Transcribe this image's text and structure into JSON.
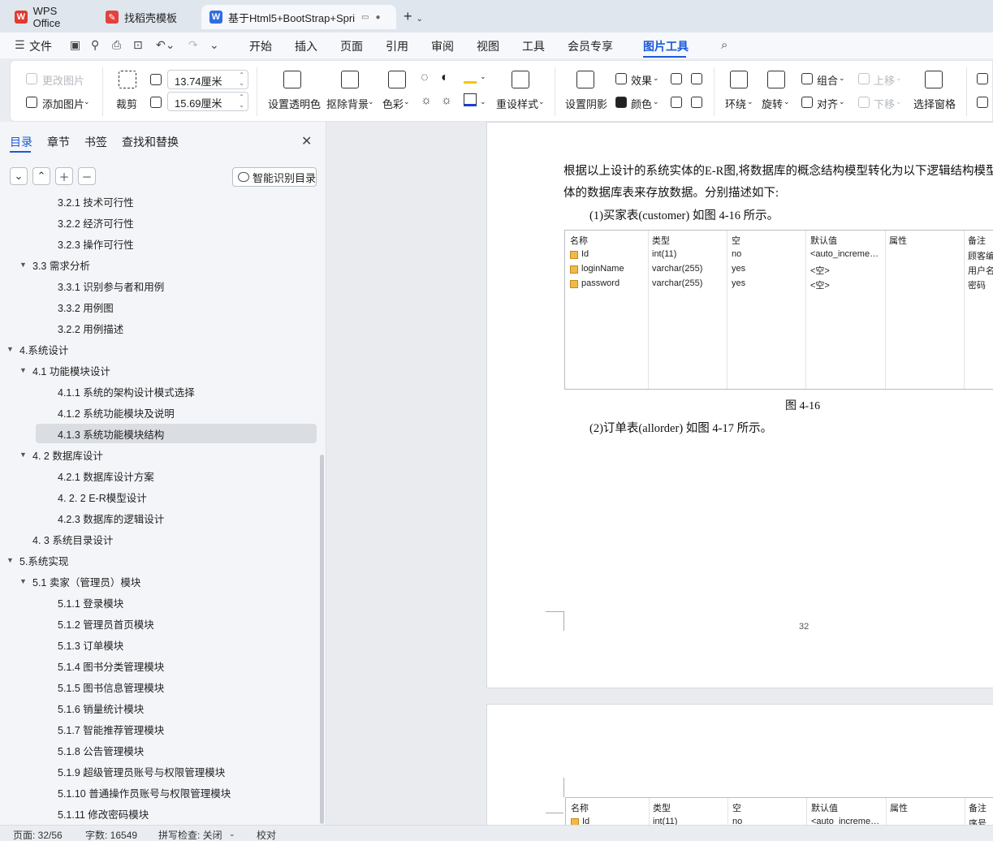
{
  "tabs": [
    {
      "label": "WPS Office"
    },
    {
      "label": "找稻壳模板"
    },
    {
      "label": "基于Html5+BootStrap+Spri"
    }
  ],
  "menu": {
    "file": "文件",
    "items": [
      "开始",
      "插入",
      "页面",
      "引用",
      "审阅",
      "视图",
      "工具",
      "会员专享",
      "图片工具"
    ]
  },
  "ribbon": {
    "change_image": "更改图片",
    "add_image": "添加图片",
    "crop": "裁剪",
    "width": "13.74厘米",
    "height": "15.69厘米",
    "set_transparent": "设置透明色",
    "remove_bg": "抠除背景",
    "color": "色彩",
    "preset_style": "重设样式",
    "set_shadow": "设置阴影",
    "effects": "效果",
    "fill_color": "颜色",
    "wrap": "环绕",
    "rotate": "旋转",
    "group": "组合",
    "align": "对齐",
    "move_up": "上移",
    "move_down": "下移",
    "selection_pane": "选择窗格"
  },
  "left_panel": {
    "tabs": [
      "目录",
      "章节",
      "书签",
      "查找和替换"
    ],
    "smart_btn": "智能识别目录",
    "toc": [
      {
        "label": "3.2.1 技术可行性",
        "level": 3
      },
      {
        "label": "3.2.2 经济可行性",
        "level": 3
      },
      {
        "label": "3.2.3 操作可行性",
        "level": 3
      },
      {
        "label": "3.3  需求分析",
        "level": 2,
        "expanded": true
      },
      {
        "label": "3.3.1  识别参与者和用例",
        "level": 3
      },
      {
        "label": "3.3.2  用例图",
        "level": 3
      },
      {
        "label": "3.2.2 用例描述",
        "level": 3
      },
      {
        "label": "4.系统设计",
        "level": 1,
        "expanded": true
      },
      {
        "label": "4.1 功能模块设计",
        "level": 2,
        "expanded": true
      },
      {
        "label": "4.1.1 系统的架构设计模式选择",
        "level": 3
      },
      {
        "label": "4.1.2 系统功能模块及说明",
        "level": 3
      },
      {
        "label": "4.1.3 系统功能模块结构",
        "level": 3,
        "selected": true
      },
      {
        "label": "4. 2 数据库设计",
        "level": 2,
        "expanded": true
      },
      {
        "label": "4.2.1 数据库设计方案",
        "level": 3
      },
      {
        "label": "4. 2. 2 E-R模型设计",
        "level": 3
      },
      {
        "label": "4.2.3 数据库的逻辑设计",
        "level": 3
      },
      {
        "label": "4. 3  系统目录设计",
        "level": 2
      },
      {
        "label": "5.系统实现",
        "level": 1,
        "expanded": true
      },
      {
        "label": "5.1  卖家（管理员）模块",
        "level": 2,
        "expanded": true
      },
      {
        "label": "5.1.1  登录模块",
        "level": 3
      },
      {
        "label": "5.1.2  管理员首页模块",
        "level": 3
      },
      {
        "label": "5.1.3  订单模块",
        "level": 3
      },
      {
        "label": "5.1.4  图书分类管理模块",
        "level": 3
      },
      {
        "label": "5.1.5  图书信息管理模块",
        "level": 3
      },
      {
        "label": "5.1.6  销量统计模块",
        "level": 3
      },
      {
        "label": "5.1.7  智能推荐管理模块",
        "level": 3
      },
      {
        "label": "5.1.8  公告管理模块",
        "level": 3
      },
      {
        "label": "5.1.9  超级管理员账号与权限管理模块",
        "level": 3
      },
      {
        "label": "5.1.10  普通操作员账号与权限管理模块",
        "level": 3
      },
      {
        "label": "5.1.11  修改密码模块",
        "level": 3
      }
    ]
  },
  "document": {
    "para1_line1": "根据以上设计的系统实体的E-R图,将数据库的概念结构模型转化为以下逻辑结构模型,则",
    "para1_line2": "体的数据库表来存放数据。分别描述如下:",
    "para2": "(1)买家表(customer)  如图 4-16 所示。",
    "table_headers": [
      "名称",
      "类型",
      "空",
      "默认值",
      "属性",
      "备注"
    ],
    "table_rows": [
      [
        "Id",
        "int(11)",
        "no",
        "<auto_increme…",
        "",
        "顾客编"
      ],
      [
        "loginName",
        "varchar(255)",
        "yes",
        "<空>",
        "",
        "用户名"
      ],
      [
        "password",
        "varchar(255)",
        "yes",
        "<空>",
        "",
        "密码"
      ]
    ],
    "caption": "图  4-16",
    "para3": "(2)订单表(allorder)  如图 4-17 所示。",
    "page_number": "32",
    "table2_headers": [
      "名称",
      "类型",
      "空",
      "默认值",
      "属性",
      "备注"
    ],
    "table2_row": [
      "Id",
      "int(11)",
      "no",
      "<auto_increme…",
      "",
      "序号"
    ]
  },
  "status": {
    "page": "页面: 32/56",
    "words": "字数: 16549",
    "spell": "拼写检查: 关闭",
    "proof": "校对"
  }
}
